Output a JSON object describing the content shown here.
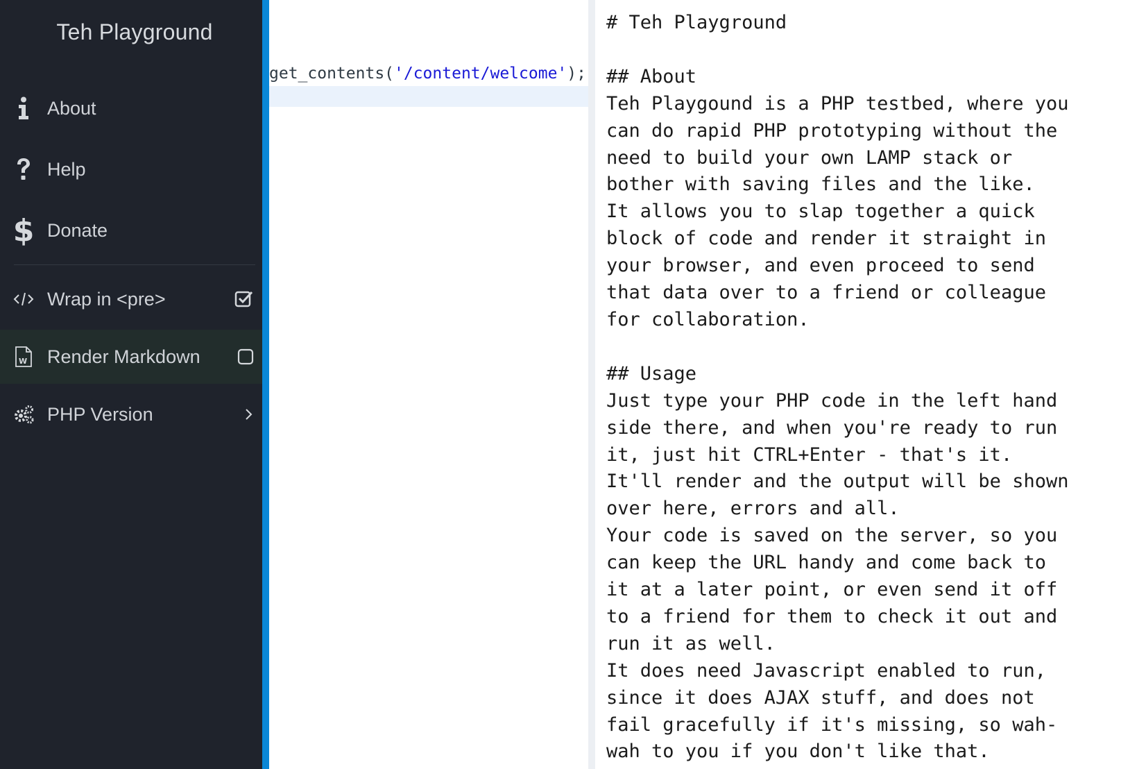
{
  "sidebar": {
    "title": "Teh Playground",
    "items": [
      {
        "label": "About",
        "icon": "info-icon"
      },
      {
        "label": "Help",
        "icon": "question-icon"
      },
      {
        "label": "Donate",
        "icon": "dollar-icon"
      },
      {
        "label": "Wrap in <pre>",
        "icon": "code-icon",
        "checked": true
      },
      {
        "label": "Render Markdown",
        "icon": "word-file-icon",
        "checked": false
      },
      {
        "label": "PHP Version",
        "icon": "gears-icon"
      }
    ]
  },
  "editor": {
    "code_prefix": "get_contents(",
    "code_string": "'/content/welcome'",
    "code_suffix": ");"
  },
  "output": {
    "text": "# Teh Playground\n\n## About\nTeh Playgound is a PHP testbed, where you\ncan do rapid PHP prototyping without the\nneed to build your own LAMP stack or\nbother with saving files and the like.\nIt allows you to slap together a quick\nblock of code and render it straight in\nyour browser, and even proceed to send\nthat data over to a friend or colleague\nfor collaboration.\n\n## Usage\nJust type your PHP code in the left hand\nside there, and when you're ready to run\nit, just hit CTRL+Enter - that's it.\nIt'll render and the output will be shown\nover here, errors and all.\nYour code is saved on the server, so you\ncan keep the URL handy and come back to\nit at a later point, or even send it off\nto a friend for them to check it out and\nrun it as well.\nIt does need Javascript enabled to run,\nsince it does AJAX stuff, and does not\nfail gracefully if it's missing, so wah-\nwah to you if you don't like that."
  },
  "colors": {
    "sidebar_bg": "#1f232c",
    "accent_blue": "#0a87d6",
    "active_item_bg": "#222d2c",
    "string_color": "#1a1ad6"
  }
}
